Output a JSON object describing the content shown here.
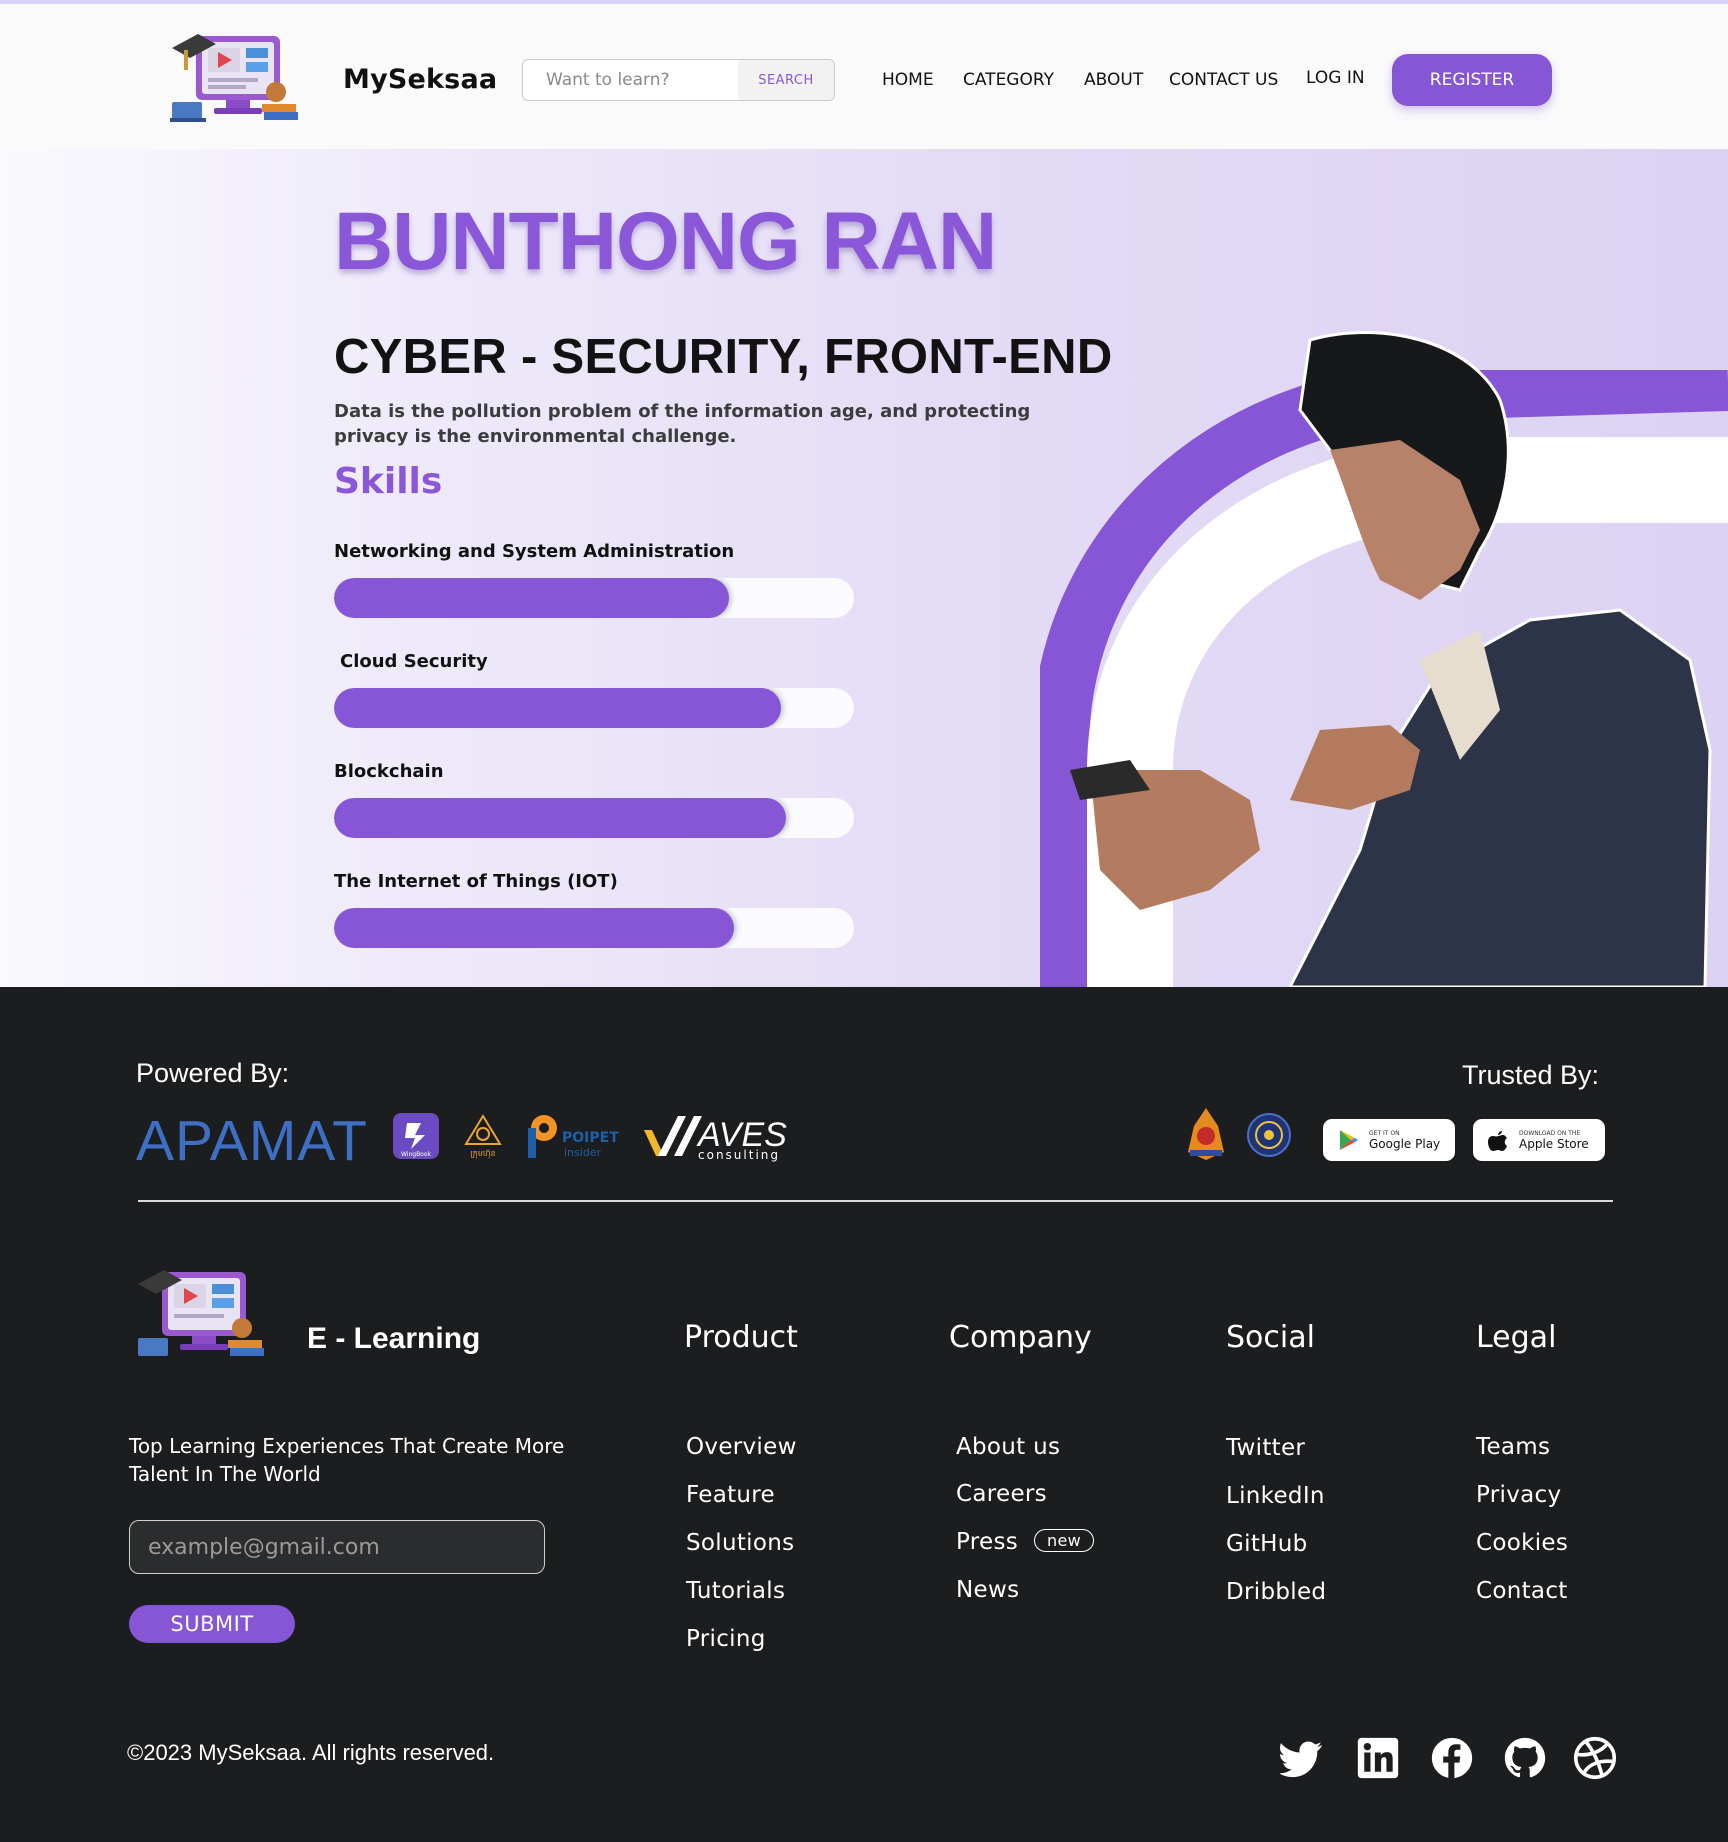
{
  "header": {
    "brand": "MySeksaa",
    "search_placeholder": "Want to learn?",
    "search_button": "SEARCH",
    "nav": [
      "HOME",
      "CATEGORY",
      "ABOUT",
      "CONTACT US",
      "LOG IN"
    ],
    "register": "REGISTER",
    "logo_icon": "elearning-computer-logo"
  },
  "hero": {
    "name": "BUNTHONG RAN",
    "role": "CYBER - SECURITY, FRONT-END",
    "quote": "Data is the pollution problem of the information age, and protecting privacy is the environmental challenge.",
    "skills_heading": "Skills",
    "skills": [
      {
        "label": "Networking and System Administration",
        "level": 0.76
      },
      {
        "label": "Cloud Security",
        "level": 0.86
      },
      {
        "label": "Blockchain",
        "level": 0.87
      },
      {
        "label": "The Internet of Things (IOT)",
        "level": 0.77
      }
    ],
    "accent": "#8656d6"
  },
  "footer": {
    "powered_by": "Powered By:",
    "trusted_by": "Trusted By:",
    "sponsors": {
      "apamat": "APAMAT",
      "wingbook": "WingBook",
      "sponsor3": "ក្រុមហ៊ុន",
      "poipet": "POIPET",
      "poipet_sub": "insider",
      "aves": "AVES",
      "aves_sub": "consulting"
    },
    "stores": {
      "google_small": "GET IT ON",
      "google_big": "Google Play",
      "apple_small": "DOWNLOAD ON THE",
      "apple_big": "Apple Store"
    },
    "brand": "E - Learning",
    "tagline": "Top Learning Experiences That Create More Talent In The World",
    "email_placeholder": "example@gmail.com",
    "submit": "SUBMIT",
    "columns": [
      {
        "heading": "Product",
        "links": [
          "Overview",
          "Feature",
          "Solutions",
          "Tutorials",
          "Pricing"
        ]
      },
      {
        "heading": "Company",
        "links": [
          "About us",
          "Careers",
          "Press",
          "News"
        ]
      },
      {
        "heading": "Social",
        "links": [
          "Twitter",
          "LinkedIn",
          "GitHub",
          "Dribbled"
        ]
      },
      {
        "heading": "Legal",
        "links": [
          "Teams",
          "Privacy",
          "Cookies",
          "Contact"
        ]
      }
    ],
    "press_badge": "new",
    "copyright": "©2023 MySeksaa. All rights reserved.",
    "social_icons": [
      "twitter-icon",
      "linkedin-icon",
      "facebook-icon",
      "github-icon",
      "dribbble-icon"
    ]
  }
}
